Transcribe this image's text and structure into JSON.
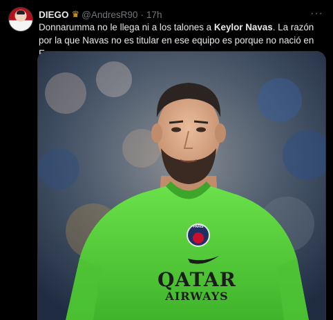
{
  "tweet": {
    "author_name": "DIEGO",
    "badge_icon": "crown-icon",
    "handle": "@AndresR90",
    "separator": "·",
    "time": "17h",
    "more_label": "···",
    "text_before": "Donnarumma no le llega ni a los talones a ",
    "text_bold": "Keylor Navas",
    "text_after": ". La razón por la que Navas no es titular en ese equipo es porque no nació en Europa."
  },
  "photo": {
    "crest_text": "PARIS",
    "sponsor_line1": "QATAR",
    "sponsor_line2": "AIRWAYS",
    "shirt_color": "#58d43c"
  }
}
